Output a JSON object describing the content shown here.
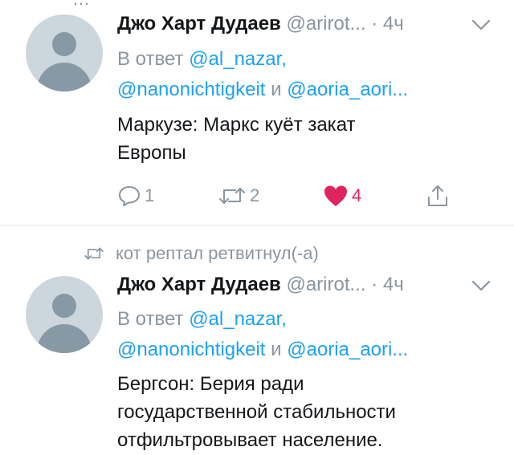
{
  "tweets": [
    {
      "author_name": "Джо Харт Дудаев",
      "handle": "@arirot...",
      "time": "· 4ч",
      "reply_prefix": "В ответ",
      "mention_1": "@al_nazar,",
      "mention_2": "@nanonichtigkeit",
      "reply_and": "и",
      "mention_3": "@aoria_aori...",
      "text_line_1": "Маркузе: Маркс куёт закат",
      "text_line_2": "Европы",
      "reply_count": "1",
      "retweet_count": "2",
      "like_count": "4",
      "liked": true
    },
    {
      "retweet_context": "кот рептал ретвитнул(-а)",
      "author_name": "Джо Харт Дудаев",
      "handle": "@arirot...",
      "time": "· 4ч",
      "reply_prefix": "В ответ",
      "mention_1": "@al_nazar,",
      "mention_2": "@nanonichtigkeit",
      "reply_and": "и",
      "mention_3": "@aoria_aori...",
      "text_line_1": "Бергсон: Берия ради",
      "text_line_2": "государственной стабильности",
      "text_line_3": "отфильтровывает население."
    }
  ],
  "colors": {
    "accent": "#1da1f2",
    "like": "#e0245e",
    "secondary_text": "#8a959e",
    "primary_text": "#14171a"
  },
  "icons": {
    "reply": "speech-bubble-icon",
    "retweet": "retweet-arrows-icon",
    "like": "heart-icon",
    "share": "share-upload-icon",
    "menu": "chevron-down-icon"
  }
}
